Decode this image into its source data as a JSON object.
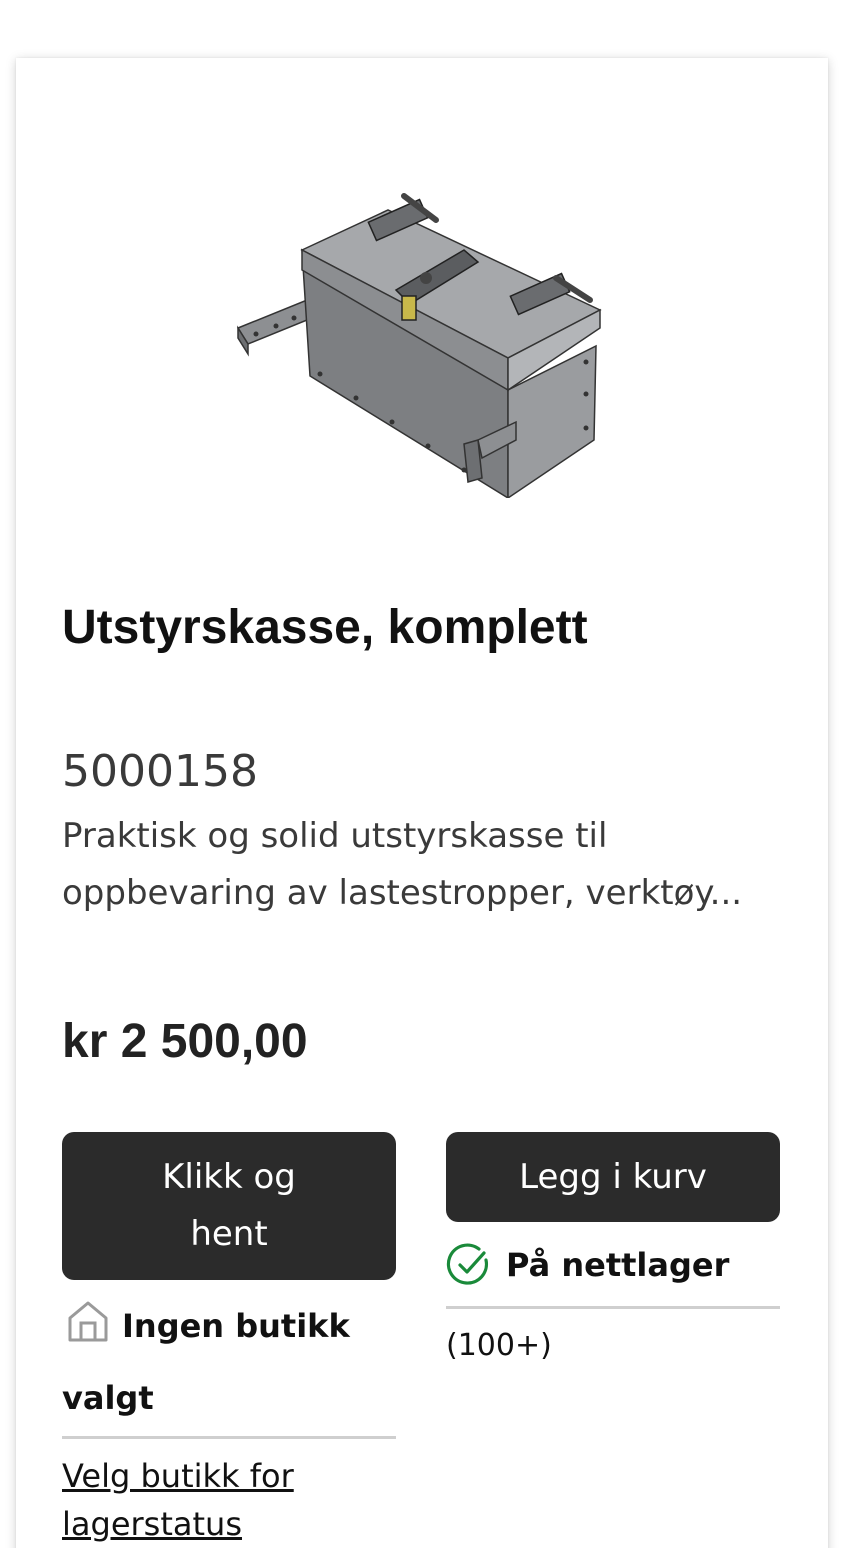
{
  "product": {
    "title": "Utstyrskasse, komplett",
    "sku": "5000158",
    "description": "Praktisk og solid utstyrskasse til oppbevaring av lastestropper, verktøy...",
    "price": "kr 2 500,00",
    "image_icon": "equipment-box-image"
  },
  "actions": {
    "click_collect_label": "Klikk og hent",
    "add_to_cart_label": "Legg i kurv"
  },
  "availability": {
    "online_label": "På nettlager",
    "online_count": "(100+)",
    "online_icon": "check-circle-icon",
    "online_color": "#1a8a3a",
    "store_label": "Ingen butikk valgt",
    "store_icon": "store-icon",
    "store_link": "Velg butikk for lagerstatus"
  },
  "colors": {
    "button_bg": "#2b2b2b",
    "text": "#111111"
  }
}
